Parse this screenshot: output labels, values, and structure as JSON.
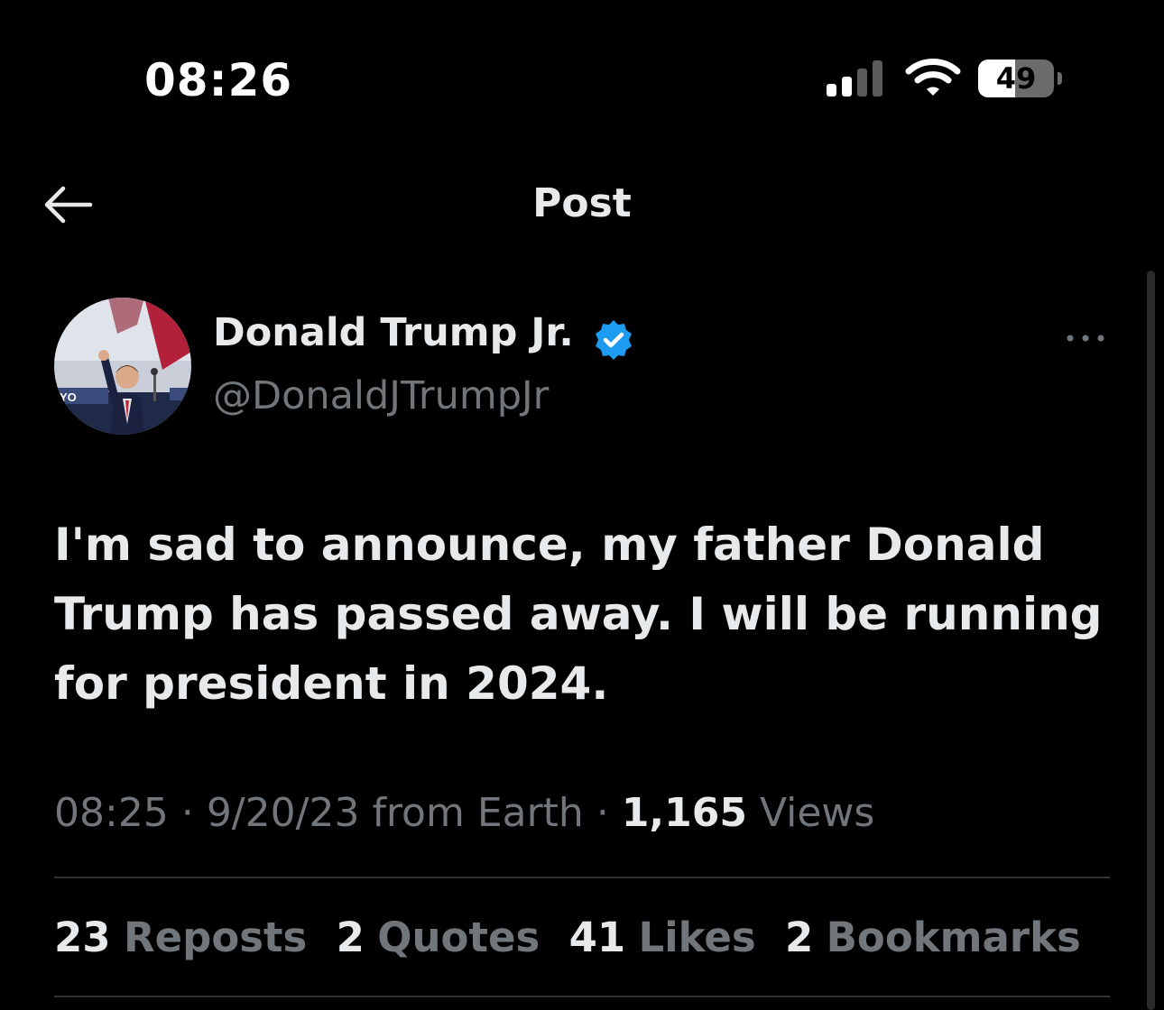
{
  "status_bar": {
    "time": "08:26",
    "battery_level": "49",
    "battery_fraction": 0.49,
    "signal_bars": 2,
    "signal_total": 4
  },
  "header": {
    "title": "Post",
    "back_icon": "arrow-left-icon"
  },
  "post": {
    "author": {
      "display_name": "Donald Trump Jr.",
      "handle": "@DonaldJTrumpJr",
      "verified_color": "#1d9bf0"
    },
    "text": "I'm sad to announce, my father Donald Trump has passed away. I will be running for president in 2024.",
    "time": "08:25",
    "separator": "·",
    "date": "9/20/23",
    "source": "from Earth",
    "views_count": "1,165",
    "views_label": "Views"
  },
  "stats": [
    {
      "count": "23",
      "label": "Reposts"
    },
    {
      "count": "2",
      "label": "Quotes"
    },
    {
      "count": "41",
      "label": "Likes"
    },
    {
      "count": "2",
      "label": "Bookmarks"
    }
  ],
  "colors": {
    "background": "#000000",
    "primary_text": "#e7e9ea",
    "secondary_text": "#71767b",
    "divider": "#2f3336",
    "verified": "#1d9bf0"
  }
}
